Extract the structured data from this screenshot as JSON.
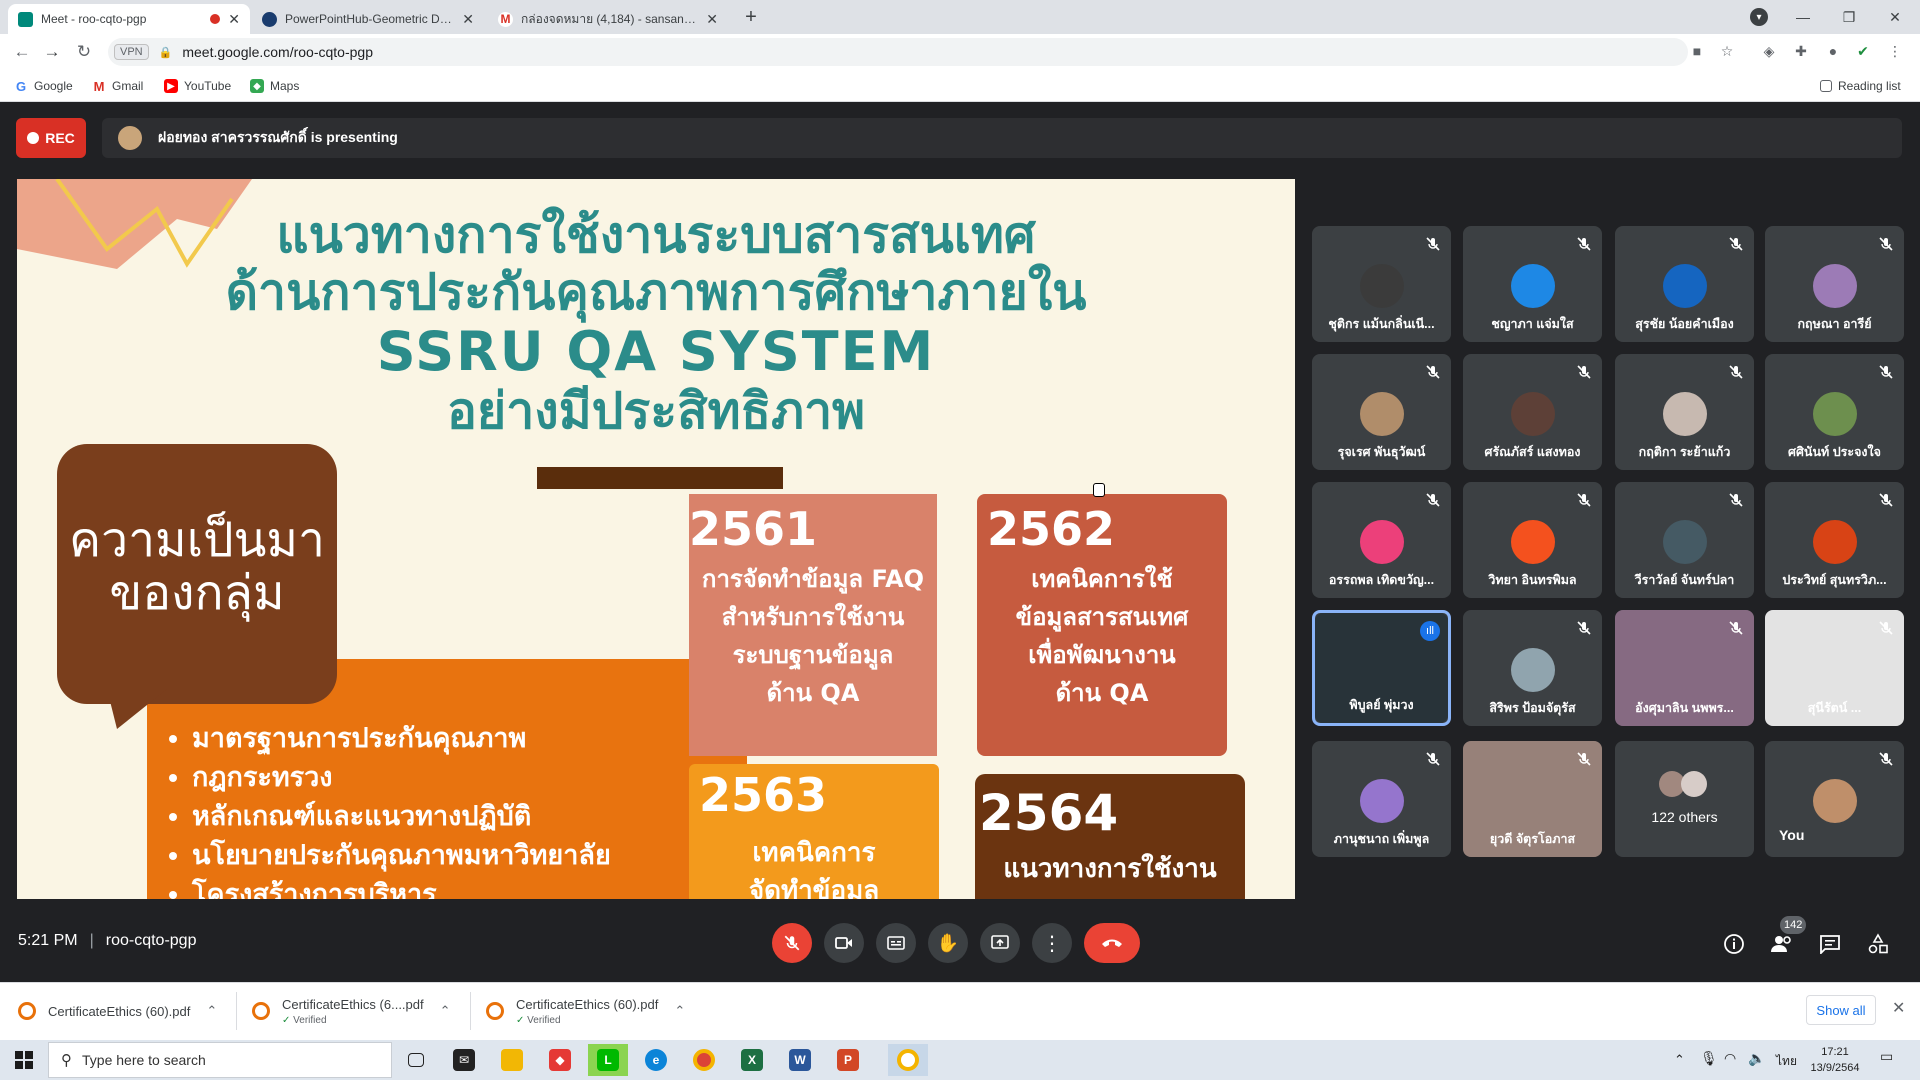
{
  "browser": {
    "tabs": [
      {
        "title": "Meet - roo-cqto-pgp"
      },
      {
        "title": "PowerPointHub-Geometric Desig"
      },
      {
        "title": "กล่องจดหมาย (4,184) - sansanee.je"
      }
    ],
    "url": "meet.google.com/roo-cqto-pgp",
    "vpn_label": "VPN",
    "bookmarks": [
      "Google",
      "Gmail",
      "YouTube",
      "Maps"
    ],
    "reading_list": "Reading list"
  },
  "meeting": {
    "rec_label": "REC",
    "presenting_text": "ฝอยทอง สาครวรรณศักดิ์ is presenting",
    "time": "5:21 PM",
    "code": "roo-cqto-pgp",
    "participant_count": "142"
  },
  "slide": {
    "title_lines": [
      "แนวทางการใช้งานระบบสารสนเทศ",
      "ด้านการประกันคุณภาพการศึกษาภายใน",
      "SSRU QA SYSTEM",
      "อย่างมีประสิทธิภาพ"
    ],
    "background_lines": [
      "ความเป็นมา",
      "ของกลุ่ม"
    ],
    "bullets": [
      "มาตรฐานการประกันคุณภาพ",
      "กฎกระทรวง",
      "หลักเกณฑ์และแนวทางปฏิบัติ",
      "นโยบายประกันคุณภาพมหาวิทยาลัย",
      "โครงสร้างการบริหาร"
    ],
    "box_2561": {
      "year": "2561",
      "lines": [
        "การจัดทำข้อมูล FAQ",
        "สำหรับการใช้งาน",
        "ระบบฐานข้อมูล",
        "ด้าน QA"
      ]
    },
    "box_2562": {
      "year": "2562",
      "lines": [
        "เทคนิคการใช้",
        "ข้อมูลสารสนเทศ",
        "เพื่อพัฒนางาน",
        "ด้าน QA"
      ]
    },
    "box_2563": {
      "year": "2563",
      "lines": [
        "เทคนิคการ",
        "จัดทำข้อมูล"
      ]
    },
    "box_2564": {
      "year": "2564",
      "lines": [
        "แนวทางการใช้งาน"
      ]
    }
  },
  "participants": [
    {
      "name": "ชุติกร แม้นกลิ่นเนี...",
      "color": "#3b3b3b"
    },
    {
      "name": "ชญาภา แจ่มใส",
      "color": "#1e88e5"
    },
    {
      "name": "สุรชัย น้อยคำเมือง",
      "color": "#1565c0"
    },
    {
      "name": "กฤษณา อารีย์",
      "color": "#9c7bb6"
    },
    {
      "name": "รุจเรศ พันธุวัฒน์",
      "color": "#b08d6a"
    },
    {
      "name": "ศรัณภัสร์ แสงทอง",
      "color": "#5d4037"
    },
    {
      "name": "กฤติกา ระย้าแก้ว",
      "color": "#c7b9b0"
    },
    {
      "name": "ศศินันท์ ประจงใจ",
      "color": "#6d8f4e"
    },
    {
      "name": "อรรถพล เทิดขวัญ...",
      "color": "#ec407a"
    },
    {
      "name": "วิทยา อินทรพิมล",
      "color": "#f4511e"
    },
    {
      "name": "วีราวัลย์ จันทร์ปลา",
      "color": "#455a64"
    },
    {
      "name": "ประวิทย์ สุนทรวิภ...",
      "color": "#d84315"
    },
    {
      "name": "พิบูลย์ พุ่มวง",
      "color": "#263238"
    },
    {
      "name": "สิริพร ป้อมจัตุรัส",
      "color": "#90a4ae"
    },
    {
      "name": "อังศุมาลิน นพพร...",
      "color": "#8e6f8a"
    },
    {
      "name": "สุนีรัตน์ ...",
      "color": "#f5f5f5"
    },
    {
      "name": "ภานุชนาถ เพิ่มพูล",
      "color": "#9575cd"
    },
    {
      "name": "ยุวดี จัตุรโอภาส",
      "color": "#a1887f"
    }
  ],
  "others_label": "122 others",
  "you_label": "You",
  "downloads": [
    {
      "name": "CertificateEthics (60).pdf",
      "status": ""
    },
    {
      "name": "CertificateEthics (6....pdf",
      "status": "Verified"
    },
    {
      "name": "CertificateEthics (60).pdf",
      "status": "Verified"
    }
  ],
  "show_all": "Show all",
  "taskbar": {
    "search_placeholder": "Type here to search",
    "clock_time": "17:21",
    "clock_date": "13/9/2564",
    "lang": "ไทย"
  }
}
